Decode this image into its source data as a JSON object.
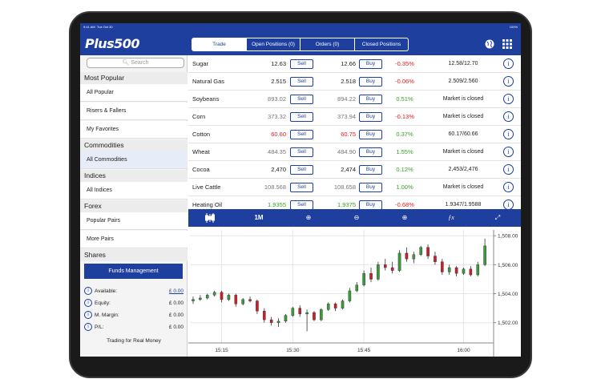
{
  "status": {
    "time": "9:41 AM",
    "date": "Tue Oct 30",
    "battery": "100%"
  },
  "brand": "Plus500",
  "tabs": [
    {
      "label": "Trade",
      "active": true
    },
    {
      "label": "Open Positions (0)",
      "active": false
    },
    {
      "label": "Orders (0)",
      "active": false
    },
    {
      "label": "Closed Positions",
      "active": false
    }
  ],
  "sidebar": {
    "search_placeholder": "Search",
    "sections": [
      {
        "title": "Most Popular",
        "items": [
          "All Popular",
          "Risers & Fallers",
          "My Favorites"
        ]
      },
      {
        "title": "Commodities",
        "items": [
          "All Commodities"
        ]
      },
      {
        "title": "Indices",
        "items": [
          "All Indices"
        ]
      },
      {
        "title": "Forex",
        "items": [
          "Popular Pairs",
          "More Pairs"
        ]
      },
      {
        "title": "Shares",
        "items": []
      }
    ],
    "selected_item": "All Commodities",
    "funds_button": "Funds Management",
    "account": [
      {
        "label": "Available:",
        "value": "£ 0.00",
        "link": true
      },
      {
        "label": "Equity:",
        "value": "£ 0.00",
        "link": false
      },
      {
        "label": "M. Margin:",
        "value": "£ 0.00",
        "link": false
      },
      {
        "label": "P/L:",
        "value": "£ 0.00",
        "link": false
      }
    ],
    "mode": "Trading for Real Money"
  },
  "instruments": [
    {
      "name": "Sugar",
      "sell": "12.63",
      "buy": "12.66",
      "change": "-0.35%",
      "range": "12.58/12.70",
      "price_color": "dark",
      "change_color": "red"
    },
    {
      "name": "Natural Gas",
      "sell": "2.515",
      "buy": "2.518",
      "change": "-0.06%",
      "range": "2.509/2.560",
      "price_color": "dark",
      "change_color": "red"
    },
    {
      "name": "Soybeans",
      "sell": "893.02",
      "buy": "894.22",
      "change": "0.51%",
      "range": "Market is closed",
      "price_color": "gray",
      "change_color": "green"
    },
    {
      "name": "Corn",
      "sell": "373.32",
      "buy": "373.94",
      "change": "-0.13%",
      "range": "Market is closed",
      "price_color": "gray",
      "change_color": "red"
    },
    {
      "name": "Cotton",
      "sell": "60.60",
      "buy": "60.75",
      "change": "0.37%",
      "range": "60.17/60.66",
      "price_color": "red",
      "change_color": "green"
    },
    {
      "name": "Wheat",
      "sell": "484.35",
      "buy": "484.90",
      "change": "1.55%",
      "range": "Market is closed",
      "price_color": "gray",
      "change_color": "green"
    },
    {
      "name": "Cocoa",
      "sell": "2,470",
      "buy": "2,474",
      "change": "0.12%",
      "range": "2,453/2,476",
      "price_color": "dark",
      "change_color": "green"
    },
    {
      "name": "Live Cattle",
      "sell": "108.568",
      "buy": "108.658",
      "change": "1.00%",
      "range": "Market is closed",
      "price_color": "gray",
      "change_color": "green"
    },
    {
      "name": "Heating Oil",
      "sell": "1.9355",
      "buy": "1.9375",
      "change": "-0.68%",
      "range": "1.9347/1.9588",
      "price_color": "green",
      "change_color": "red"
    }
  ],
  "buttons": {
    "sell": "Sell",
    "buy": "Buy"
  },
  "chart_toolbar": {
    "period": "1M"
  },
  "chart_data": {
    "type": "candlestick",
    "x_ticks": [
      "15:15",
      "15:30",
      "15:45",
      "16:00"
    ],
    "y_ticks": [
      "1,502.00",
      "1,504.00",
      "1,506.00",
      "1,508.00"
    ],
    "ylim": [
      1500.6,
      1508.4
    ],
    "candles": [
      [
        1503.5,
        1503.8,
        1503.3,
        1503.6
      ],
      [
        1503.6,
        1503.9,
        1503.5,
        1503.7
      ],
      [
        1503.7,
        1504.0,
        1503.6,
        1503.9
      ],
      [
        1503.9,
        1504.2,
        1503.8,
        1504.1
      ],
      [
        1504.1,
        1504.2,
        1503.4,
        1503.6
      ],
      [
        1503.6,
        1504.0,
        1503.5,
        1503.9
      ],
      [
        1503.9,
        1504.0,
        1503.1,
        1503.3
      ],
      [
        1503.3,
        1503.7,
        1503.2,
        1503.6
      ],
      [
        1503.6,
        1503.8,
        1503.4,
        1503.5
      ],
      [
        1503.5,
        1503.6,
        1502.6,
        1502.8
      ],
      [
        1502.8,
        1503.0,
        1502.0,
        1502.2
      ],
      [
        1502.2,
        1502.4,
        1501.8,
        1502.0
      ],
      [
        1502.0,
        1502.3,
        1501.7,
        1502.1
      ],
      [
        1502.1,
        1502.6,
        1502.0,
        1502.5
      ],
      [
        1502.5,
        1503.1,
        1502.4,
        1503.0
      ],
      [
        1503.0,
        1503.2,
        1502.4,
        1502.6
      ],
      [
        1502.6,
        1502.9,
        1501.4,
        1502.7
      ],
      [
        1502.7,
        1502.8,
        1502.1,
        1502.2
      ],
      [
        1502.2,
        1503.0,
        1502.1,
        1502.9
      ],
      [
        1502.9,
        1503.4,
        1502.8,
        1503.3
      ],
      [
        1503.3,
        1503.4,
        1502.8,
        1503.0
      ],
      [
        1503.0,
        1503.6,
        1502.9,
        1503.5
      ],
      [
        1503.5,
        1504.4,
        1503.4,
        1504.2
      ],
      [
        1504.2,
        1504.8,
        1504.1,
        1504.6
      ],
      [
        1504.6,
        1505.6,
        1504.5,
        1505.4
      ],
      [
        1505.4,
        1505.8,
        1504.8,
        1505.0
      ],
      [
        1505.0,
        1506.2,
        1504.9,
        1506.0
      ],
      [
        1506.0,
        1506.4,
        1505.6,
        1505.8
      ],
      [
        1505.8,
        1506.2,
        1505.4,
        1505.6
      ],
      [
        1505.6,
        1507.0,
        1505.5,
        1506.8
      ],
      [
        1506.8,
        1507.2,
        1506.2,
        1506.4
      ],
      [
        1506.4,
        1506.9,
        1506.1,
        1506.7
      ],
      [
        1506.7,
        1507.3,
        1506.6,
        1507.2
      ],
      [
        1507.2,
        1507.4,
        1506.4,
        1506.6
      ],
      [
        1506.6,
        1506.9,
        1506.0,
        1506.2
      ],
      [
        1506.2,
        1506.4,
        1505.3,
        1505.5
      ],
      [
        1505.5,
        1506.0,
        1505.3,
        1505.8
      ],
      [
        1505.8,
        1505.9,
        1505.2,
        1505.4
      ],
      [
        1505.4,
        1505.8,
        1505.3,
        1505.7
      ],
      [
        1505.7,
        1505.9,
        1505.2,
        1505.3
      ],
      [
        1505.3,
        1506.2,
        1505.2,
        1506.0
      ],
      [
        1506.0,
        1507.8,
        1505.9,
        1507.3
      ]
    ]
  }
}
